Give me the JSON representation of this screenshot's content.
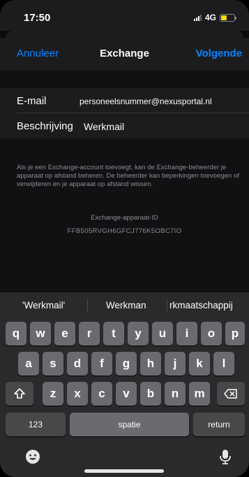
{
  "status": {
    "time": "17:50",
    "network": "4G",
    "battery_color": "#ffd60a"
  },
  "nav": {
    "cancel": "Annuleer",
    "title": "Exchange",
    "next": "Volgende",
    "accent": "#0a84ff"
  },
  "form": {
    "email_label": "E-mail",
    "email_value": "personeelsnummer@nexusportal.nl",
    "desc_label": "Beschrijving",
    "desc_value": "Werkmail"
  },
  "footer": {
    "note": "Als je een Exchange-account toevoegt, kan de Exchange-beheerder je apparaat op afstand beheren. De beheerder kan beperkingen toevoegen of verwijderen en je apparaat op afstand wissen.",
    "device_id_label": "Exchange-apparaat-ID",
    "device_id": "FFB505RVGH6GFCJ776K5OBC7IO"
  },
  "keyboard": {
    "predictions": [
      "'Werkmail'",
      "Werkman",
      "rkmaatschappij"
    ],
    "row1": [
      "q",
      "w",
      "e",
      "r",
      "t",
      "y",
      "u",
      "i",
      "o",
      "p"
    ],
    "row2": [
      "a",
      "s",
      "d",
      "f",
      "g",
      "h",
      "j",
      "k",
      "l"
    ],
    "row3": [
      "z",
      "x",
      "c",
      "v",
      "b",
      "n",
      "m"
    ],
    "numbers_label": "123",
    "space_label": "spatie",
    "return_label": "return",
    "shift_icon": "shift-icon",
    "delete_icon": "backspace-icon",
    "emoji_icon": "emoji-icon",
    "mic_icon": "microphone-icon"
  }
}
